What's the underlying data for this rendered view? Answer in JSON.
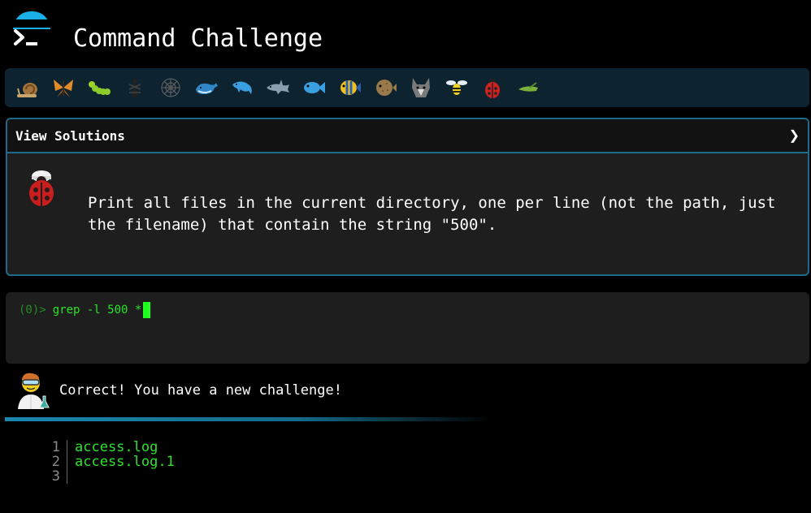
{
  "app": {
    "title": "Command Challenge"
  },
  "toolbar": {
    "animals": [
      {
        "name": "snail-icon",
        "color": "#8a6a3a"
      },
      {
        "name": "butterfly-icon",
        "color": "#e08a2a"
      },
      {
        "name": "caterpillar-icon",
        "color": "#8ccc2a"
      },
      {
        "name": "ant-icon",
        "color": "#202020"
      },
      {
        "name": "spider-icon",
        "color": "#606060"
      },
      {
        "name": "whale-icon",
        "color": "#2a7fc0"
      },
      {
        "name": "dolphin-icon",
        "color": "#3a9fe0"
      },
      {
        "name": "shark-icon",
        "color": "#8aa0b0"
      },
      {
        "name": "fish-icon",
        "color": "#3a9fe0"
      },
      {
        "name": "tropical-fish-icon",
        "color": "#f0c020"
      },
      {
        "name": "blowfish-icon",
        "color": "#8a6a3a"
      },
      {
        "name": "wolf-icon",
        "color": "#7a7a7a"
      },
      {
        "name": "bee-icon",
        "color": "#f0d020"
      },
      {
        "name": "ladybug-icon",
        "color": "#d02020"
      },
      {
        "name": "cricket-icon",
        "color": "#7ab03a"
      }
    ]
  },
  "panel": {
    "header": "View Solutions",
    "chevron": "❯",
    "challenge": "Print all files in the current directory, one per line (not the path, just the filename) that contain the string \"500\"."
  },
  "terminal": {
    "exit_code": "(0)>",
    "command": "grep -l 500 *"
  },
  "status": {
    "message": "Correct! You have a new challenge!"
  },
  "output": {
    "lines": [
      {
        "num": "1",
        "text": "access.log"
      },
      {
        "num": "2",
        "text": "access.log.1"
      },
      {
        "num": "3",
        "text": ""
      }
    ]
  }
}
